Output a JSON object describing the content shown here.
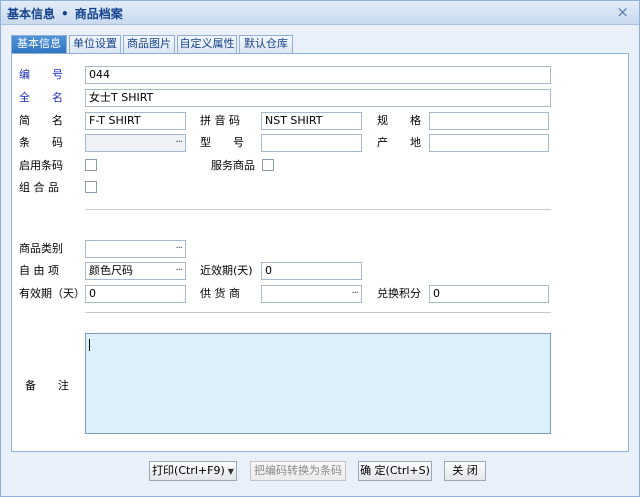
{
  "window": {
    "breadcrumb_root": "基本信息",
    "breadcrumb_sep": "•",
    "breadcrumb_current": "商品档案",
    "close_glyph": "×"
  },
  "tabs": [
    {
      "label": "基本信息",
      "active": true
    },
    {
      "label": "单位设置",
      "active": false
    },
    {
      "label": "商品图片",
      "active": false
    },
    {
      "label": "自定义属性",
      "active": false
    },
    {
      "label": "默认仓库",
      "active": false
    }
  ],
  "form": {
    "code_label": "编　　号",
    "code_value": "044",
    "fullname_label": "全　　名",
    "fullname_value": "女士T SHIRT",
    "shortname_label": "简　　名",
    "shortname_value": "F-T SHIRT",
    "pinyin_label": "拼 音 码",
    "pinyin_value": "NST SHIRT",
    "spec_label": "规　　格",
    "spec_value": "",
    "barcode_label": "条　　码",
    "barcode_value": "",
    "model_label": "型　　号",
    "model_value": "",
    "origin_label": "产　　地",
    "origin_value": "",
    "enable_barcode_label": "启用条码",
    "service_goods_label": "服务商品",
    "combo_label": "组 合 品",
    "category_label": "商品类别",
    "category_value": "",
    "free_item_label": "自 由 项",
    "free_item_value": "颜色尺码",
    "near_expiry_label": "近效期(天)",
    "near_expiry_value": "0",
    "validity_label": "有效期（天）",
    "validity_value": "0",
    "supplier_label": "供 货 商",
    "supplier_value": "",
    "points_label": "兑换积分",
    "points_value": "0",
    "remark_label": "备　　注",
    "remark_value": "",
    "trigger_glyph": "···"
  },
  "buttons": {
    "print": "打印(Ctrl+F9)",
    "print_arrow": "▼",
    "convert": "把编码转换为条码",
    "ok": "确 定(Ctrl+S)",
    "close": "关 闭"
  },
  "colors": {
    "accent": "#2f73bd",
    "label_blue": "#1f2fb8",
    "memo_bg": "#dbf0fa",
    "window_bg": "#e9f0f9"
  }
}
